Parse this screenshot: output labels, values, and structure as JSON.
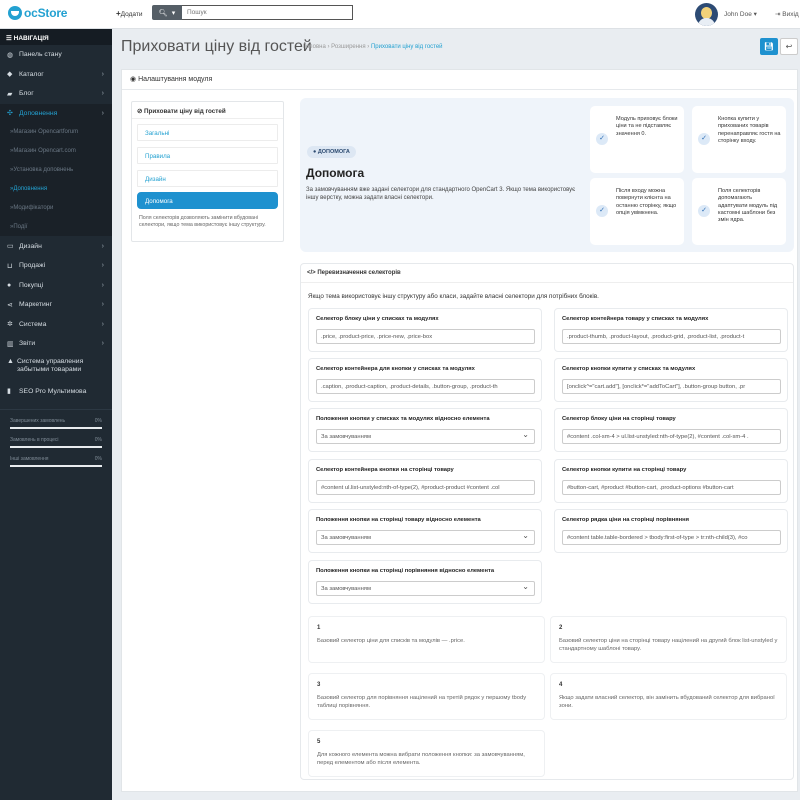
{
  "header": {
    "logo": "ocStore",
    "add_label": "Додати",
    "search_placeholder": "Пошук",
    "user_name": "John Doe",
    "logout_label": "Вихід"
  },
  "sidebar": {
    "nav_title": "НАВІГАЦІЯ",
    "items": [
      {
        "label": "Панель стану",
        "icon": "dashboard-icon"
      },
      {
        "label": "Каталог",
        "icon": "tag-icon",
        "has_children": true
      },
      {
        "label": "Блог",
        "icon": "folder-icon",
        "has_children": true
      },
      {
        "label": "Доповнення",
        "icon": "puzzle-icon",
        "has_children": true,
        "active": true
      }
    ],
    "submenu": [
      "Магазин Opencartforum",
      "Магазин Opencart.com",
      "Установка доповнень",
      "Доповнення",
      "Модифікатори",
      "Події"
    ],
    "current_submenu": "Доповнення",
    "items_after": [
      {
        "label": "Дизайн",
        "icon": "monitor-icon",
        "has_children": true
      },
      {
        "label": "Продажі",
        "icon": "cart-icon",
        "has_children": true
      },
      {
        "label": "Покупці",
        "icon": "user-icon",
        "has_children": true
      },
      {
        "label": "Маркетинг",
        "icon": "share-icon",
        "has_children": true
      },
      {
        "label": "Система",
        "icon": "gear-icon",
        "has_children": true
      },
      {
        "label": "Звіти",
        "icon": "bar-chart-icon",
        "has_children": true
      },
      {
        "label": "Система управления забытыми товарами",
        "icon": "lock-icon"
      },
      {
        "label": "SEO Pro Мультимова",
        "icon": "book-icon"
      }
    ],
    "stats": [
      {
        "label": "Завершених замовлень",
        "value": "0%",
        "fill": 1
      },
      {
        "label": "Замовлень в процесі",
        "value": "0%",
        "fill": 1
      },
      {
        "label": "Інші замовлення",
        "value": "0%",
        "fill": 1
      }
    ]
  },
  "page": {
    "title": "Приховати ціну від гостей",
    "breadcrumb": [
      "Головна",
      "Розширення",
      "Приховати ціну від гостей"
    ],
    "panel_title": "Налаштування модуля"
  },
  "tabs": {
    "heading": "Приховати ціну від гостей",
    "items": [
      "Загальні",
      "Правила",
      "Дизайн",
      "Допомога"
    ],
    "active": "Допомога",
    "note": "Поля селекторів дозволяють замінити вбудовані селектори, якщо тема використовує іншу структуру."
  },
  "help": {
    "badge": "ДОПОМОГА",
    "title": "Допомога",
    "description": "За замовчуванням вже задані селектори для стандартного OpenCart 3. Якщо тема використовує іншу верстку, можна задати власні селектори.",
    "cards": [
      "Модуль приховує блоки ціни та не підставляє значення 0.",
      "Кнопка купити у прихованих товарів перенаправляє гостя на сторінку входу.",
      "Після входу можна повернути клієнта на останню сторінку, якщо опція увімкнена.",
      "Поля селекторів допомагають адаптувати модуль під кастомні шаблони без змін ядра."
    ]
  },
  "selectors": {
    "heading": "Перевизначення селекторів",
    "intro": "Якщо тема використовує іншу структуру або класи, задайте власні селектори для потрібних блоків.",
    "fields": [
      {
        "label": "Селектор блоку ціни у списках та модулях",
        "value": ".price, .product-price, .price-new, .price-box",
        "type": "input"
      },
      {
        "label": "Селектор контейнера товару у списках та модулях",
        "value": ".product-thumb, .product-layout, .product-grid, .product-list, .product-t",
        "type": "input"
      },
      {
        "label": "Селектор контейнера для кнопки у списках та модулях",
        "value": ".caption, .product-caption, .product-details, .button-group, .product-th",
        "type": "input"
      },
      {
        "label": "Селектор кнопки купити у списках та модулях",
        "value": "[onclick^=\"cart.add\"], [onclick*=\"addToCart\"], .button-group button, .pr",
        "type": "input"
      },
      {
        "label": "Положення кнопки у списках та модулях відносно елемента",
        "value": "За замовчуванням",
        "type": "select"
      },
      {
        "label": "Селектор блоку ціни на сторінці товару",
        "value": "#content .col-sm-4 > ul.list-unstyled:nth-of-type(2), #content .col-sm-4 .",
        "type": "input"
      },
      {
        "label": "Селектор контейнера кнопки на сторінці товару",
        "value": "#content ul.list-unstyled:nth-of-type(2), #product-product #content .col",
        "type": "input"
      },
      {
        "label": "Селектор кнопки купити на сторінці товару",
        "value": "#button-cart, #product #button-cart, .product-options #button-cart",
        "type": "input"
      },
      {
        "label": "Положення кнопки на сторінці товару відносно елемента",
        "value": "За замовчуванням",
        "type": "select"
      },
      {
        "label": "Селектор рядка ціни на сторінці порівняння",
        "value": "#content table.table-bordered > tbody:first-of-type > tr:nth-child(3), #co",
        "type": "input"
      },
      {
        "label": "Положення кнопки на сторінці порівняння відносно елемента",
        "value": "За замовчуванням",
        "type": "select"
      }
    ],
    "notes": [
      {
        "num": "1",
        "text": "Базовий селектор ціни для списків та модулів — .price."
      },
      {
        "num": "2",
        "text": "Базовий селектор ціни на сторінці товару націлений на другий блок list-unstyled у стандартному шаблоні товару."
      },
      {
        "num": "3",
        "text": "Базовий селектор для порівняння націлений на третій рядок у першому tbody таблиці порівняння."
      },
      {
        "num": "4",
        "text": "Якщо задати власний селектор, він замінить вбудований селектор для вибраної зони."
      },
      {
        "num": "5",
        "text": "Для кожного елемента можна вибрати положення кнопки: за замовчуванням, перед елементом або після елемента."
      }
    ]
  }
}
